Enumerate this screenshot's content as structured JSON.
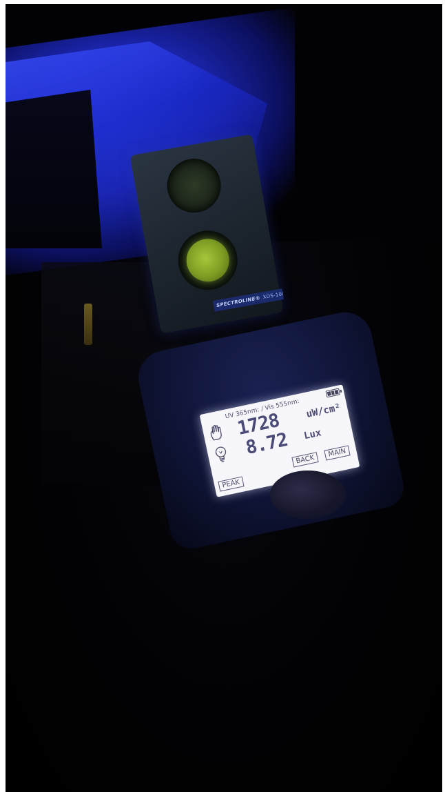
{
  "sensor": {
    "brand": "SPECTROLINE®",
    "model": "XDS-1000"
  },
  "lcd": {
    "header": "UV 365nm: / Vis 555nm:",
    "uv_value": "1728",
    "uv_unit": "uW/cm²",
    "vis_value": "8.72",
    "vis_unit": "Lux",
    "buttons": {
      "back": "BACK",
      "main": "MAIN",
      "peak": "PEAK"
    },
    "battery_level": 1.0
  },
  "icons": {
    "hand": "hand-icon",
    "bulb": "lightbulb-icon",
    "battery": "battery-icon"
  },
  "colors": {
    "uv_glow": "#2f3fe0",
    "lens_green": "#a6c73a",
    "lcd_bg": "#f7f7fb",
    "lcd_text": "#4b4b78"
  }
}
